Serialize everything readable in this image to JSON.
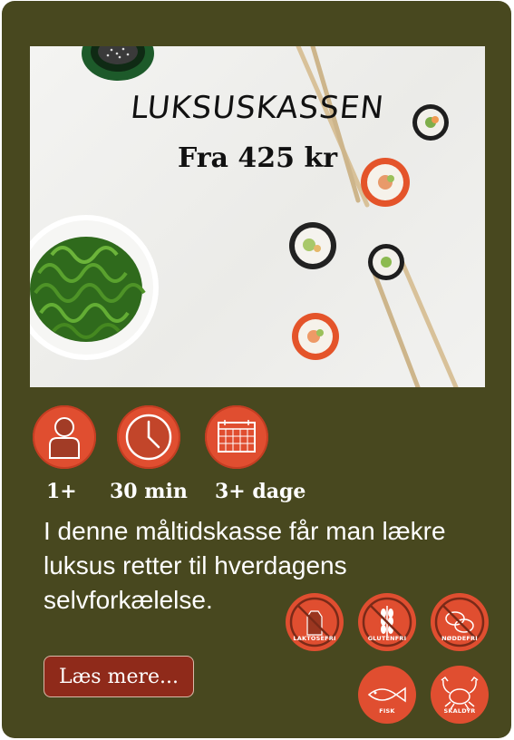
{
  "hero": {
    "title": "LUKSUSKASSEN",
    "price": "Fra 425 kr"
  },
  "stats": [
    {
      "icon": "person-icon",
      "label": "1+"
    },
    {
      "icon": "clock-icon",
      "label": "30 min"
    },
    {
      "icon": "calendar-icon",
      "label": "3+ dage"
    }
  ],
  "description": "I denne måltidskasse får man lækre luksus retter til hverdagens selvforkælelse.",
  "button": {
    "label": "Læs mere..."
  },
  "allergens": [
    {
      "icon": "milk-carton-icon",
      "label": "LAKTOSEFRI"
    },
    {
      "icon": "wheat-icon",
      "label": "GLUTENFRI"
    },
    {
      "icon": "nut-icon",
      "label": "NØDDEFRI"
    },
    {
      "icon": "fish-icon",
      "label": "FISK"
    },
    {
      "icon": "crab-icon",
      "label": "SKALDYR"
    }
  ],
  "colors": {
    "card_background": "#48481f",
    "accent": "#e04e30",
    "button": "#8f2a1a"
  }
}
